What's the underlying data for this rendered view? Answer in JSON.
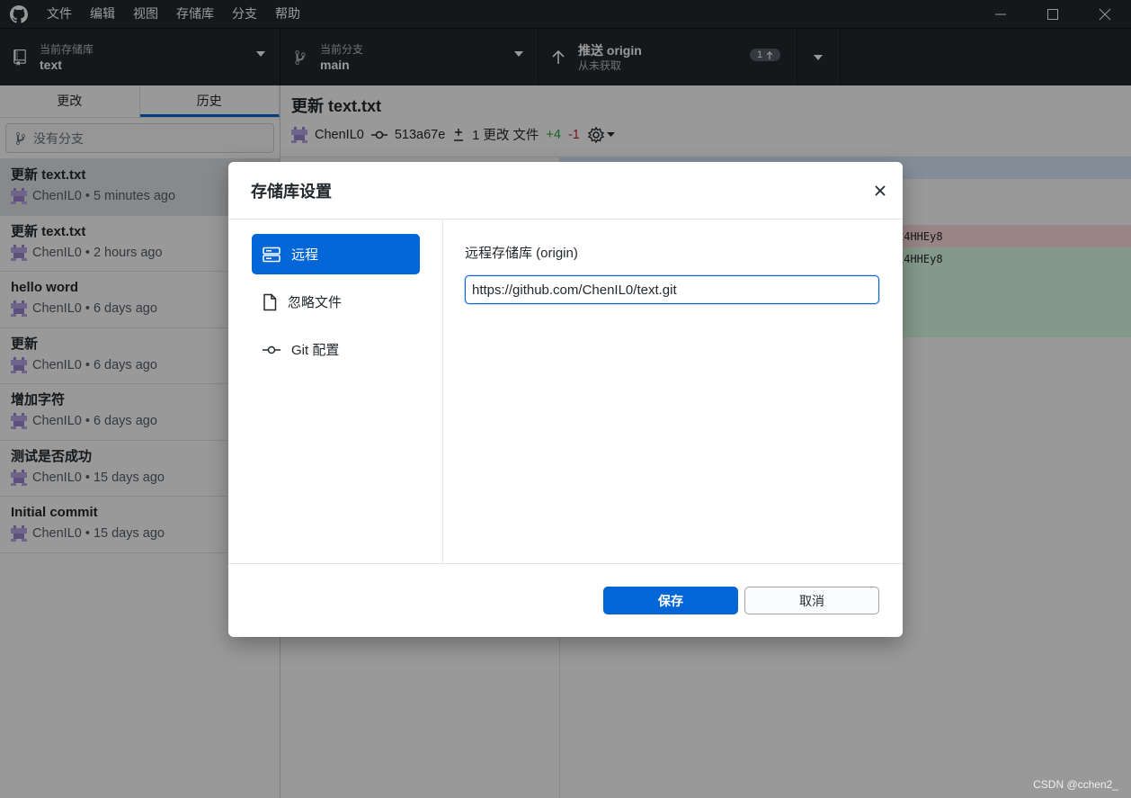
{
  "menu": [
    "文件",
    "编辑",
    "视图",
    "存储库",
    "分支",
    "帮助"
  ],
  "toolbar": {
    "repo_label": "当前存储库",
    "repo_name": "text",
    "branch_label": "当前分支",
    "branch_name": "main",
    "push_label": "推送 origin",
    "push_sub": "从未获取",
    "push_count": "1"
  },
  "sidebar": {
    "tabs": [
      "更改",
      "历史"
    ],
    "active_tab": "历史",
    "filter_placeholder": "没有分支",
    "commits": [
      {
        "title": "更新 text.txt",
        "meta": "ChenIL0 • 5 minutes ago"
      },
      {
        "title": "更新 text.txt",
        "meta": "ChenIL0 • 2 hours ago"
      },
      {
        "title": "hello word",
        "meta": "ChenIL0 • 6 days ago"
      },
      {
        "title": "更新",
        "meta": "ChenIL0 • 6 days ago"
      },
      {
        "title": "增加字符",
        "meta": "ChenIL0 • 6 days ago"
      },
      {
        "title": "测试是否成功",
        "meta": "ChenIL0 • 15 days ago"
      },
      {
        "title": "Initial commit",
        "meta": "ChenIL0 • 15 days ago"
      }
    ]
  },
  "main": {
    "commit_title": "更新 text.txt",
    "author": "ChenIL0",
    "sha": "513a67e",
    "files_changed": "1 更改 文件",
    "additions": "+4",
    "deletions": "-1",
    "diff_line_1": "x4HHEy8",
    "diff_line_2": "x4HHEy8"
  },
  "dialog": {
    "title": "存储库设置",
    "nav": [
      "远程",
      "忽略文件",
      "Git 配置"
    ],
    "active_nav": "远程",
    "field_label": "远程存储库 (origin)",
    "remote_url": "https://github.com/ChenIL0/text.git",
    "save_label": "保存",
    "cancel_label": "取消"
  },
  "watermark": "CSDN @cchen2_",
  "colors": {
    "accent": "#0366d6",
    "toolbar_bg": "#24292e",
    "addition": "#28a745",
    "deletion": "#cb2431"
  }
}
